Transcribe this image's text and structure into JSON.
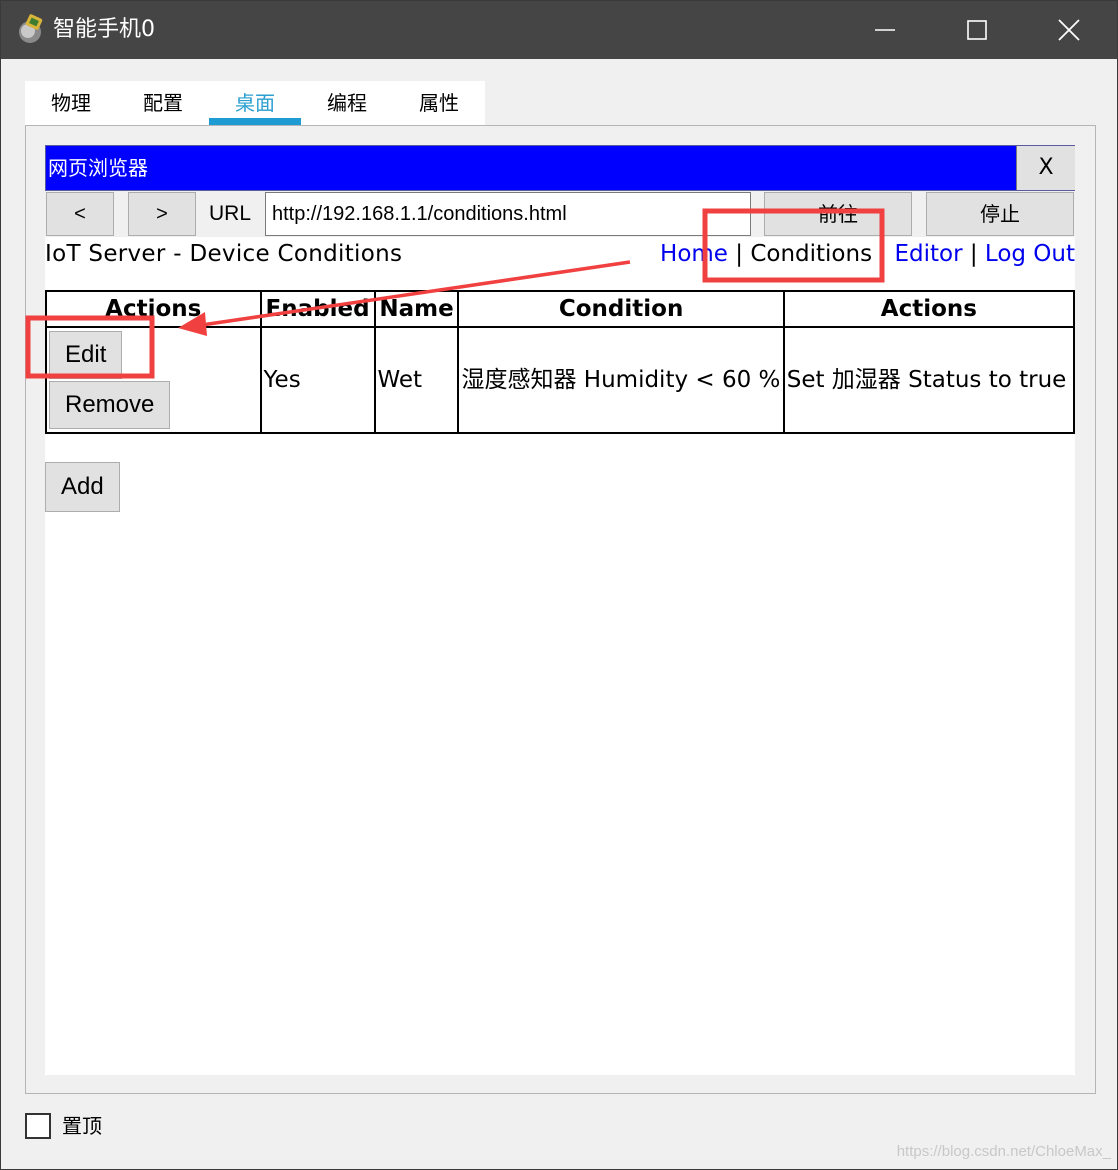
{
  "window": {
    "title": "智能手机0",
    "icon": "phone-app-icon",
    "controls": [
      "minimize-icon",
      "maximize-icon",
      "close-icon"
    ]
  },
  "tabs": [
    {
      "label": "物理",
      "active": false
    },
    {
      "label": "配置",
      "active": false
    },
    {
      "label": "桌面",
      "active": true
    },
    {
      "label": "编程",
      "active": false
    },
    {
      "label": "属性",
      "active": false
    }
  ],
  "browser": {
    "title": "网页浏览器",
    "close_label": "X",
    "back_label": "<",
    "forward_label": ">",
    "url_label": "URL",
    "url_value": "http://192.168.1.1/conditions.html",
    "go_label": "前往",
    "stop_label": "停止"
  },
  "page": {
    "title": "IoT Server - Device Conditions",
    "nav": {
      "home": "Home",
      "sep1": " | ",
      "conditions": "Conditions",
      "sep2": " | ",
      "editor": "Editor",
      "sep3": " | ",
      "logout": "Log Out"
    },
    "table": {
      "headers": [
        "Actions",
        "Enabled",
        "Name",
        "Condition",
        "Actions"
      ],
      "rows": [
        {
          "edit_label": "Edit",
          "remove_label": "Remove",
          "enabled": "Yes",
          "name": "Wet",
          "condition": "湿度感知器 Humidity < 60 %",
          "action": "Set 加湿器 Status to true"
        }
      ]
    },
    "add_label": "Add"
  },
  "footer": {
    "pin_label": "置顶",
    "pin_checked": false
  },
  "watermark": "https://blog.csdn.net/ChloeMax_",
  "colors": {
    "titlebar": "#454545",
    "browser_bar": "#0000ff",
    "active_tab": "#1e9bd2",
    "link": "#0000ee",
    "annotation": "#f04040"
  }
}
